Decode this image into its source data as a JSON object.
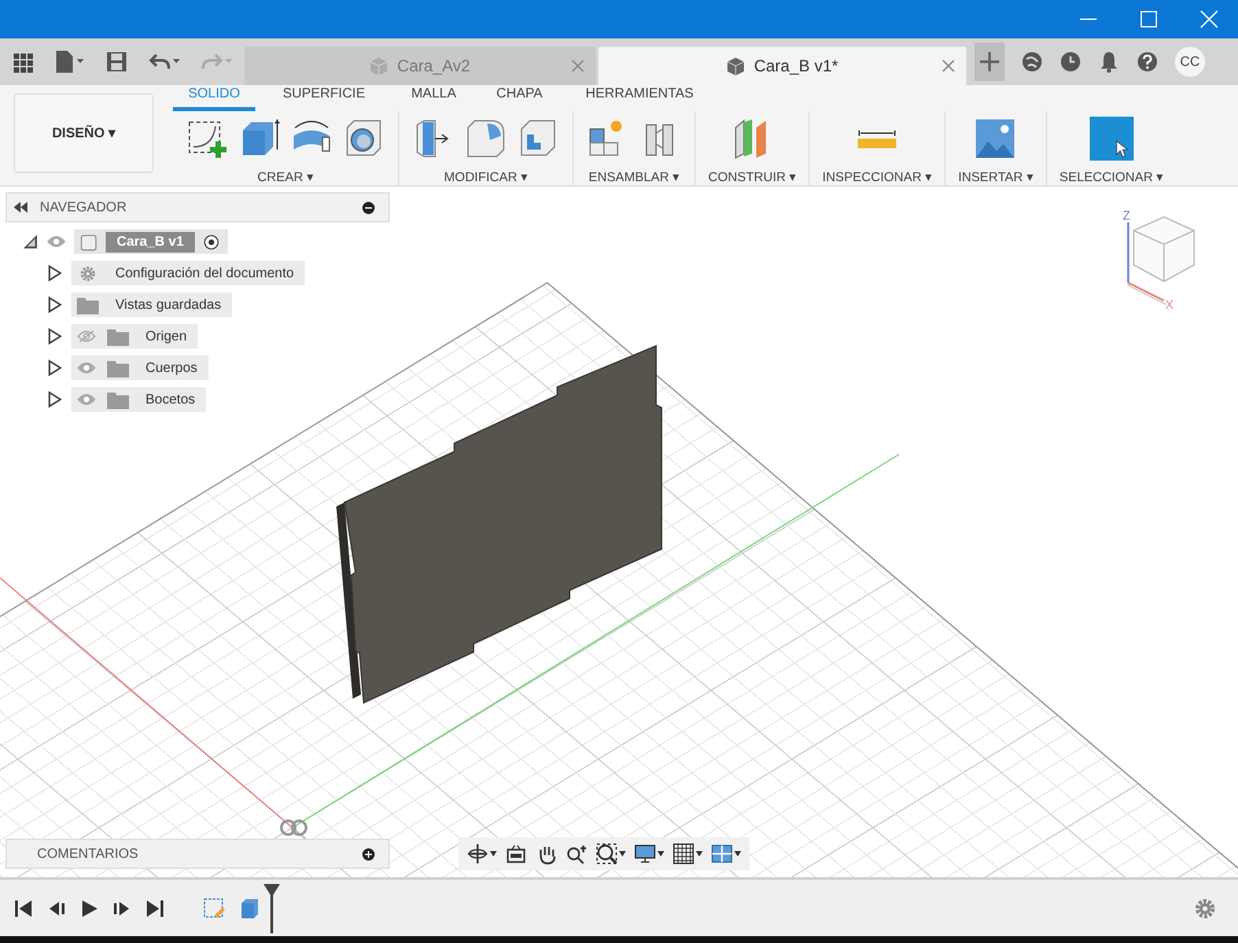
{
  "tabs": [
    {
      "label": "Cara_Av2",
      "selected": false
    },
    {
      "label": "Cara_B v1*",
      "selected": true
    }
  ],
  "user": {
    "initials": "CC"
  },
  "workspace": {
    "label": "DISEÑO ▾"
  },
  "ribbon_tabs": [
    {
      "label": "SOLIDO",
      "selected": true
    },
    {
      "label": "SUPERFICIE",
      "selected": false
    },
    {
      "label": "MALLA",
      "selected": false
    },
    {
      "label": "CHAPA",
      "selected": false
    },
    {
      "label": "HERRAMIENTAS",
      "selected": false
    }
  ],
  "tool_groups": [
    {
      "label": "CREAR ▾",
      "tools": [
        {
          "kind": "sketch"
        },
        {
          "kind": "extrude"
        },
        {
          "kind": "revolve"
        },
        {
          "kind": "hole"
        }
      ]
    },
    {
      "label": "MODIFICAR ▾",
      "tools": [
        {
          "kind": "presspull"
        },
        {
          "kind": "fillet"
        },
        {
          "kind": "shell"
        }
      ]
    },
    {
      "label": "ENSAMBLAR ▾",
      "tools": [
        {
          "kind": "component"
        },
        {
          "kind": "joint"
        }
      ]
    },
    {
      "label": "CONSTRUIR ▾",
      "tools": [
        {
          "kind": "plane"
        }
      ]
    },
    {
      "label": "INSPECCIONAR ▾",
      "tools": [
        {
          "kind": "measure"
        }
      ]
    },
    {
      "label": "INSERTAR ▾",
      "tools": [
        {
          "kind": "image"
        }
      ]
    },
    {
      "label": "SELECCIONAR ▾",
      "tools": [
        {
          "kind": "select"
        }
      ]
    }
  ],
  "browser": {
    "title": "NAVEGADOR",
    "root": {
      "label": "Cara_B v1",
      "visible": true,
      "expanded": true,
      "children": [
        {
          "label": "Configuración del documento",
          "kind": "settings",
          "expanded": false
        },
        {
          "label": "Vistas guardadas",
          "kind": "folder",
          "expanded": false
        },
        {
          "label": "Origen",
          "kind": "folder",
          "visible": false,
          "expanded": false
        },
        {
          "label": "Cuerpos",
          "kind": "folder",
          "visible": true,
          "expanded": false
        },
        {
          "label": "Bocetos",
          "kind": "folder",
          "visible": true,
          "expanded": false
        }
      ]
    }
  },
  "view_cube": {
    "axes": [
      {
        "label": "Z",
        "color": "#6f7fd6"
      },
      {
        "label": "X",
        "color": "#e8857a"
      }
    ]
  },
  "comments": {
    "title": "COMENTARIOS"
  },
  "nav_tools": [
    {
      "kind": "orbit",
      "dropdown": true
    },
    {
      "kind": "look",
      "dropdown": false
    },
    {
      "kind": "pan",
      "dropdown": false
    },
    {
      "kind": "zoom",
      "dropdown": false
    },
    {
      "kind": "fit",
      "dropdown": true
    },
    {
      "kind": "display",
      "dropdown": true
    },
    {
      "kind": "grid",
      "dropdown": true
    },
    {
      "kind": "viewports",
      "dropdown": true
    }
  ],
  "timeline": {
    "features": [
      {
        "kind": "sketch"
      },
      {
        "kind": "extrude"
      }
    ]
  }
}
